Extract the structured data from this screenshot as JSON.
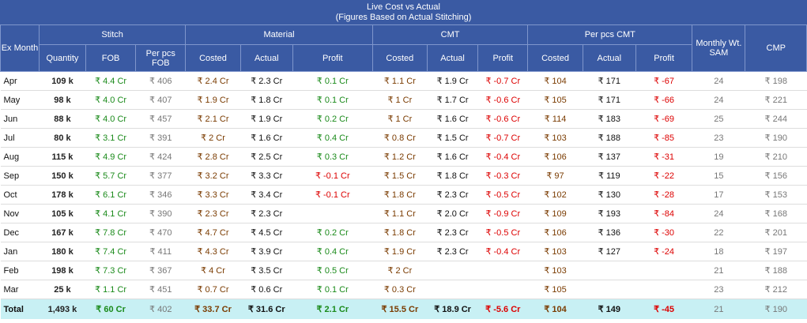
{
  "title": "Live Cost vs Actual",
  "subtitle": "(Figures Based on Actual Stitching)",
  "headers": {
    "ex_month": "Ex Month",
    "stitch": "Stitch",
    "material": "Material",
    "cmt": "CMT",
    "per_pcs_cmt": "Per pcs CMT",
    "monthly_sam": "Monthly Wt. SAM",
    "cmp": "CMP",
    "quantity": "Quantity",
    "fob": "FOB",
    "per_pcs_fob": "Per pcs FOB",
    "mat_costed": "Costed",
    "mat_actual": "Actual",
    "mat_profit": "Profit",
    "cmt_costed": "Costed",
    "cmt_actual": "Actual",
    "cmt_profit": "Profit",
    "pp_costed": "Costed",
    "pp_actual": "Actual",
    "pp_profit": "Profit"
  },
  "rows": [
    [
      "Apr",
      "109 k",
      "₹ 4.4 Cr",
      "₹ 406",
      "₹ 2.4 Cr",
      "₹ 2.3 Cr",
      "₹ 0.1 Cr",
      "₹ 1.1 Cr",
      "₹ 1.9 Cr",
      "₹ -0.7 Cr",
      "₹ 104",
      "₹ 171",
      "₹ -67",
      "24",
      "₹ 198"
    ],
    [
      "May",
      "98 k",
      "₹ 4.0 Cr",
      "₹ 407",
      "₹ 1.9 Cr",
      "₹ 1.8 Cr",
      "₹ 0.1 Cr",
      "₹ 1 Cr",
      "₹ 1.7 Cr",
      "₹ -0.6 Cr",
      "₹ 105",
      "₹ 171",
      "₹ -66",
      "24",
      "₹ 221"
    ],
    [
      "Jun",
      "88 k",
      "₹ 4.0 Cr",
      "₹ 457",
      "₹ 2.1 Cr",
      "₹ 1.9 Cr",
      "₹ 0.2 Cr",
      "₹ 1 Cr",
      "₹ 1.6 Cr",
      "₹ -0.6 Cr",
      "₹ 114",
      "₹ 183",
      "₹ -69",
      "25",
      "₹ 244"
    ],
    [
      "Jul",
      "80 k",
      "₹ 3.1 Cr",
      "₹ 391",
      "₹ 2 Cr",
      "₹ 1.6 Cr",
      "₹ 0.4 Cr",
      "₹ 0.8 Cr",
      "₹ 1.5 Cr",
      "₹ -0.7 Cr",
      "₹ 103",
      "₹ 188",
      "₹ -85",
      "23",
      "₹ 190"
    ],
    [
      "Aug",
      "115 k",
      "₹ 4.9 Cr",
      "₹ 424",
      "₹ 2.8 Cr",
      "₹ 2.5 Cr",
      "₹ 0.3 Cr",
      "₹ 1.2 Cr",
      "₹ 1.6 Cr",
      "₹ -0.4 Cr",
      "₹ 106",
      "₹ 137",
      "₹ -31",
      "19",
      "₹ 210"
    ],
    [
      "Sep",
      "150 k",
      "₹ 5.7 Cr",
      "₹ 377",
      "₹ 3.2 Cr",
      "₹ 3.3 Cr",
      "₹ -0.1 Cr",
      "₹ 1.5 Cr",
      "₹ 1.8 Cr",
      "₹ -0.3 Cr",
      "₹ 97",
      "₹ 119",
      "₹ -22",
      "15",
      "₹ 156"
    ],
    [
      "Oct",
      "178 k",
      "₹ 6.1 Cr",
      "₹ 346",
      "₹ 3.3 Cr",
      "₹ 3.4 Cr",
      "₹ -0.1 Cr",
      "₹ 1.8 Cr",
      "₹ 2.3 Cr",
      "₹ -0.5 Cr",
      "₹ 102",
      "₹ 130",
      "₹ -28",
      "17",
      "₹ 153"
    ],
    [
      "Nov",
      "105 k",
      "₹ 4.1 Cr",
      "₹ 390",
      "₹ 2.3 Cr",
      "₹ 2.3 Cr",
      "",
      "₹ 1.1 Cr",
      "₹ 2.0 Cr",
      "₹ -0.9 Cr",
      "₹ 109",
      "₹ 193",
      "₹ -84",
      "24",
      "₹ 168"
    ],
    [
      "Dec",
      "167 k",
      "₹ 7.8 Cr",
      "₹ 470",
      "₹ 4.7 Cr",
      "₹ 4.5 Cr",
      "₹ 0.2 Cr",
      "₹ 1.8 Cr",
      "₹ 2.3 Cr",
      "₹ -0.5 Cr",
      "₹ 106",
      "₹ 136",
      "₹ -30",
      "22",
      "₹ 201"
    ],
    [
      "Jan",
      "180 k",
      "₹ 7.4 Cr",
      "₹ 411",
      "₹ 4.3 Cr",
      "₹ 3.9 Cr",
      "₹ 0.4 Cr",
      "₹ 1.9 Cr",
      "₹ 2.3 Cr",
      "₹ -0.4 Cr",
      "₹ 103",
      "₹ 127",
      "₹ -24",
      "18",
      "₹ 197"
    ],
    [
      "Feb",
      "198 k",
      "₹ 7.3 Cr",
      "₹ 367",
      "₹ 4 Cr",
      "₹ 3.5 Cr",
      "₹ 0.5 Cr",
      "₹ 2 Cr",
      "",
      "",
      "₹ 103",
      "",
      "",
      "21",
      "₹ 188"
    ],
    [
      "Mar",
      "25 k",
      "₹ 1.1 Cr",
      "₹ 451",
      "₹ 0.7 Cr",
      "₹ 0.6 Cr",
      "₹ 0.1 Cr",
      "₹ 0.3 Cr",
      "",
      "",
      "₹ 105",
      "",
      "",
      "23",
      "₹ 212"
    ]
  ],
  "total": [
    "Total",
    "1,493 k",
    "₹ 60 Cr",
    "₹ 402",
    "₹ 33.7 Cr",
    "₹ 31.6 Cr",
    "₹ 2.1 Cr",
    "₹ 15.5 Cr",
    "₹ 18.9 Cr",
    "₹ -5.6 Cr",
    "₹ 104",
    "₹ 149",
    "₹ -45",
    "21",
    "₹ 190"
  ],
  "colors": {
    "header_bg": "#3a5aa3",
    "positive": "#1a8a1a",
    "negative": "#dd0000",
    "costed": "#7a3b00",
    "muted": "#777777",
    "total_bg": "#c8f0f4"
  }
}
